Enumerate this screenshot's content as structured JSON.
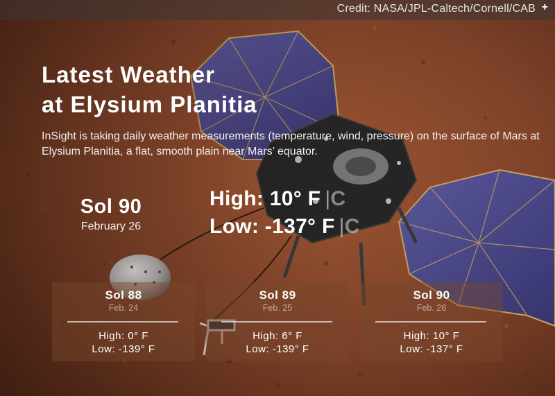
{
  "credit": {
    "text": "Credit: NASA/JPL-Caltech/Cornell/CAB",
    "toggle": "+"
  },
  "title": "Latest Weather\nat Elysium Planitia",
  "description": "InSight is taking daily weather measurements (temperature, wind, pressure) on the surface of Mars at Elysium Planitia, a flat, smooth plain near Mars’ equator.",
  "current": {
    "sol": "Sol 90",
    "date": "February 26",
    "high_label": "High: 10° F",
    "low_label": "Low: -137° F",
    "separator": "|",
    "celsius_unit": "C"
  },
  "history": [
    {
      "sol": "Sol 88",
      "date": "Feb. 24",
      "high": "High: 0° F",
      "low": "Low: -139° F"
    },
    {
      "sol": "Sol 89",
      "date": "Feb. 25",
      "high": "High: 6° F",
      "low": "Low: -139° F"
    },
    {
      "sol": "Sol 90",
      "date": "Feb. 26",
      "high": "High: 10° F",
      "low": "Low: -137° F"
    }
  ],
  "colors": {
    "mars_surface": "#8a4a2c",
    "solar_panel": "#4a4a8a",
    "lander_deck": "#2b2b2b"
  }
}
